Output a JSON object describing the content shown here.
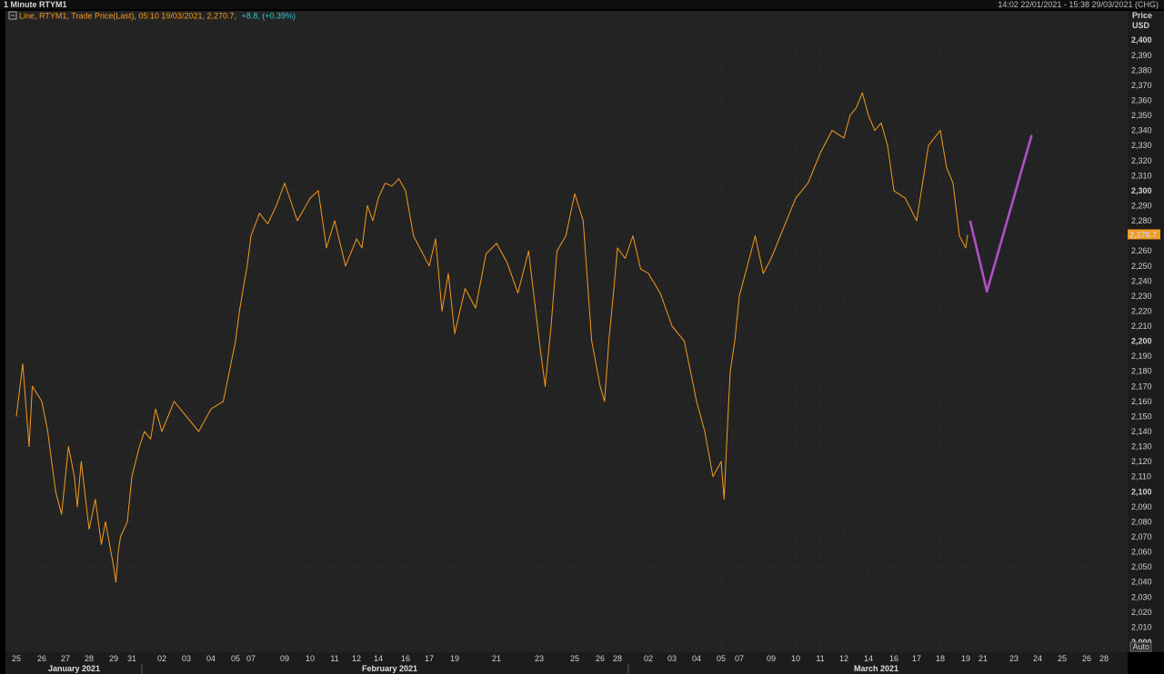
{
  "window": {
    "title": "1 Minute RTYM1",
    "range": "14:02 22/01/2021 - 15:38 29/03/2021 (CHG)"
  },
  "legend": {
    "icon": "minus-box-icon",
    "text": "Line, RTYM1, Trade Price(Last), 05:10 19/03/2021, 2,270.7,",
    "change": "+8.8, (+0.39%)"
  },
  "axis": {
    "price_label": "Price",
    "currency_label": "USD",
    "last_price": "2,270.7",
    "auto_label": "Auto"
  },
  "colors": {
    "background": "#232323",
    "grid": "#3a3a3a",
    "price_line": "#f39a1e",
    "projection": "#b04fc4",
    "last_price_tag": "#f39a1e",
    "change_text": "#34c7d4"
  },
  "chart_data": {
    "type": "line",
    "title": "",
    "xlabel": "",
    "ylabel": "Price USD",
    "ylim": [
      2000,
      2400
    ],
    "ytick_step": 10,
    "grid": true,
    "legend_position": "top-left",
    "x_ticks": [
      {
        "date": "2021-01-25",
        "label": "25"
      },
      {
        "date": "2021-01-26",
        "label": "26"
      },
      {
        "date": "2021-01-27",
        "label": "27"
      },
      {
        "date": "2021-01-28",
        "label": "28"
      },
      {
        "date": "2021-01-29",
        "label": "29"
      },
      {
        "date": "2021-01-31",
        "label": "31"
      },
      {
        "date": "2021-02-02",
        "label": "02"
      },
      {
        "date": "2021-02-03",
        "label": "03"
      },
      {
        "date": "2021-02-04",
        "label": "04"
      },
      {
        "date": "2021-02-05",
        "label": "05"
      },
      {
        "date": "2021-02-07",
        "label": "07"
      },
      {
        "date": "2021-02-09",
        "label": "09"
      },
      {
        "date": "2021-02-10",
        "label": "10"
      },
      {
        "date": "2021-02-11",
        "label": "11"
      },
      {
        "date": "2021-02-12",
        "label": "12"
      },
      {
        "date": "2021-02-14",
        "label": "14"
      },
      {
        "date": "2021-02-16",
        "label": "16"
      },
      {
        "date": "2021-02-17",
        "label": "17"
      },
      {
        "date": "2021-02-19",
        "label": "19"
      },
      {
        "date": "2021-02-21",
        "label": "21"
      },
      {
        "date": "2021-02-23",
        "label": "23"
      },
      {
        "date": "2021-02-25",
        "label": "25"
      },
      {
        "date": "2021-02-26",
        "label": "26"
      },
      {
        "date": "2021-02-28",
        "label": "28"
      },
      {
        "date": "2021-03-02",
        "label": "02"
      },
      {
        "date": "2021-03-03",
        "label": "03"
      },
      {
        "date": "2021-03-04",
        "label": "04"
      },
      {
        "date": "2021-03-05",
        "label": "05"
      },
      {
        "date": "2021-03-07",
        "label": "07"
      },
      {
        "date": "2021-03-09",
        "label": "09"
      },
      {
        "date": "2021-03-10",
        "label": "10"
      },
      {
        "date": "2021-03-11",
        "label": "11"
      },
      {
        "date": "2021-03-12",
        "label": "12"
      },
      {
        "date": "2021-03-14",
        "label": "14"
      },
      {
        "date": "2021-03-16",
        "label": "16"
      },
      {
        "date": "2021-03-17",
        "label": "17"
      },
      {
        "date": "2021-03-18",
        "label": "18"
      },
      {
        "date": "2021-03-19",
        "label": "19"
      },
      {
        "date": "2021-03-21",
        "label": "21"
      },
      {
        "date": "2021-03-23",
        "label": "23"
      },
      {
        "date": "2021-03-24",
        "label": "24"
      },
      {
        "date": "2021-03-25",
        "label": "25"
      },
      {
        "date": "2021-03-26",
        "label": "26"
      },
      {
        "date": "2021-03-28",
        "label": "28"
      }
    ],
    "months": [
      {
        "label": "January 2021",
        "start": "2021-01-25",
        "end": "2021-01-31"
      },
      {
        "label": "February 2021",
        "start": "2021-02-02",
        "end": "2021-02-28"
      },
      {
        "label": "March 2021",
        "start": "2021-03-02",
        "end": "2021-03-28"
      }
    ],
    "series": [
      {
        "name": "RTYM1",
        "role": "price",
        "x": [
          "2021-01-25T00:00",
          "2021-01-25T06:00",
          "2021-01-25T12:00",
          "2021-01-25T15:00",
          "2021-01-26T00:00",
          "2021-01-26T06:00",
          "2021-01-26T10:00",
          "2021-01-26T14:00",
          "2021-01-26T20:00",
          "2021-01-27T03:00",
          "2021-01-27T09:00",
          "2021-01-27T12:00",
          "2021-01-27T16:00",
          "2021-01-28T00:00",
          "2021-01-28T06:00",
          "2021-01-28T12:00",
          "2021-01-28T16:00",
          "2021-01-29T00:00",
          "2021-01-29T06:00",
          "2021-01-29T12:00",
          "2021-01-29T18:00",
          "2021-01-30T12:00",
          "2021-01-31T00:00",
          "2021-01-31T12:00",
          "2021-01-31T20:00",
          "2021-02-01T06:00",
          "2021-02-01T14:00",
          "2021-02-02T00:00",
          "2021-02-02T12:00",
          "2021-02-03T00:00",
          "2021-02-03T12:00",
          "2021-02-04T00:00",
          "2021-02-04T12:00",
          "2021-02-05T00:00",
          "2021-02-05T12:00",
          "2021-02-06T00:00",
          "2021-02-06T12:00",
          "2021-02-07T00:00",
          "2021-02-07T12:00",
          "2021-02-08T00:00",
          "2021-02-08T12:00",
          "2021-02-09T00:00",
          "2021-02-09T12:00",
          "2021-02-10T00:00",
          "2021-02-10T08:00",
          "2021-02-10T16:00",
          "2021-02-11T00:00",
          "2021-02-11T12:00",
          "2021-02-12T00:00",
          "2021-02-12T12:00",
          "2021-02-13T00:00",
          "2021-02-13T12:00",
          "2021-02-14T00:00",
          "2021-02-14T12:00",
          "2021-02-15T00:00",
          "2021-02-15T12:00",
          "2021-02-16T00:00",
          "2021-02-16T08:00",
          "2021-02-16T16:00",
          "2021-02-17T00:00",
          "2021-02-17T12:00",
          "2021-02-18T00:00",
          "2021-02-18T12:00",
          "2021-02-19T00:00",
          "2021-02-19T12:00",
          "2021-02-20T00:00",
          "2021-02-20T12:00",
          "2021-02-21T00:00",
          "2021-02-21T12:00",
          "2021-02-22T00:00",
          "2021-02-22T12:00",
          "2021-02-23T00:00",
          "2021-02-23T08:00",
          "2021-02-23T16:00",
          "2021-02-24T00:00",
          "2021-02-24T12:00",
          "2021-02-25T00:00",
          "2021-02-25T08:00",
          "2021-02-25T16:00",
          "2021-02-26T00:00",
          "2021-02-26T12:00",
          "2021-02-27T00:00",
          "2021-02-27T12:00",
          "2021-02-28T00:00",
          "2021-02-28T12:00",
          "2021-03-01T00:00",
          "2021-03-01T12:00",
          "2021-03-02T00:00",
          "2021-03-02T12:00",
          "2021-03-03T00:00",
          "2021-03-03T12:00",
          "2021-03-04T00:00",
          "2021-03-04T08:00",
          "2021-03-04T16:00",
          "2021-03-05T00:00",
          "2021-03-05T08:00",
          "2021-03-05T16:00",
          "2021-03-06T00:00",
          "2021-03-06T12:00",
          "2021-03-07T00:00",
          "2021-03-07T12:00",
          "2021-03-08T00:00",
          "2021-03-08T12:00",
          "2021-03-09T00:00",
          "2021-03-09T12:00",
          "2021-03-10T00:00",
          "2021-03-10T12:00",
          "2021-03-11T00:00",
          "2021-03-11T12:00",
          "2021-03-12T00:00",
          "2021-03-12T12:00",
          "2021-03-13T00:00",
          "2021-03-13T12:00",
          "2021-03-14T00:00",
          "2021-03-14T12:00",
          "2021-03-15T00:00",
          "2021-03-15T12:00",
          "2021-03-16T00:00",
          "2021-03-16T12:00",
          "2021-03-17T00:00",
          "2021-03-17T12:00",
          "2021-03-18T00:00",
          "2021-03-18T06:00",
          "2021-03-18T12:00",
          "2021-03-18T18:00",
          "2021-03-19T00:00",
          "2021-03-19T05:10"
        ],
        "y": [
          2150,
          2185,
          2130,
          2170,
          2160,
          2140,
          2120,
          2100,
          2085,
          2130,
          2110,
          2090,
          2120,
          2075,
          2095,
          2065,
          2080,
          2050,
          2040,
          2060,
          2070,
          2080,
          2110,
          2130,
          2140,
          2135,
          2155,
          2140,
          2160,
          2150,
          2140,
          2155,
          2160,
          2200,
          2220,
          2235,
          2250,
          2270,
          2285,
          2278,
          2290,
          2305,
          2280,
          2295,
          2300,
          2262,
          2280,
          2250,
          2268,
          2262,
          2290,
          2280,
          2295,
          2305,
          2303,
          2308,
          2300,
          2270,
          2260,
          2250,
          2268,
          2220,
          2245,
          2205,
          2235,
          2222,
          2258,
          2265,
          2252,
          2232,
          2260,
          2200,
          2170,
          2210,
          2260,
          2270,
          2298,
          2280,
          2200,
          2170,
          2160,
          2200,
          2230,
          2262,
          2255,
          2270,
          2248,
          2245,
          2232,
          2210,
          2200,
          2160,
          2140,
          2110,
          2120,
          2095,
          2140,
          2180,
          2200,
          2230,
          2250,
          2270,
          2245,
          2255,
          2275,
          2295,
          2305,
          2325,
          2340,
          2335,
          2350,
          2355,
          2365,
          2350,
          2340,
          2345,
          2330,
          2300,
          2295,
          2280,
          2330,
          2340,
          2315,
          2305,
          2270,
          2262,
          2270.7
        ]
      },
      {
        "name": "",
        "role": "projection",
        "x": [
          "2021-03-19T12:00",
          "2021-03-21T06:00",
          "2021-03-23T18:00"
        ],
        "y": [
          2280,
          2233,
          2337
        ]
      }
    ]
  }
}
